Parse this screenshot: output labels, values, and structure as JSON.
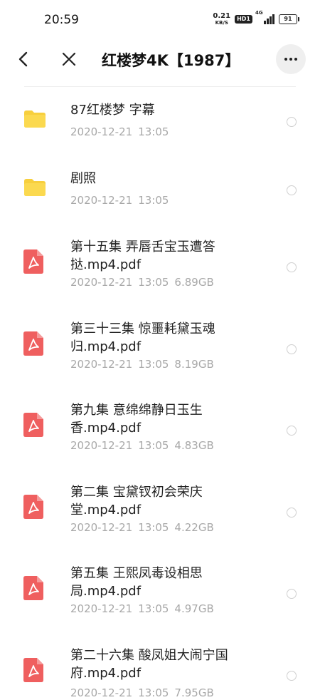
{
  "status_bar": {
    "time": "20:59",
    "net_speed_value": "0.21",
    "net_speed_unit": "KB/S",
    "hd_label": "HD1",
    "network_label": "4G",
    "battery": "91"
  },
  "header": {
    "title": "红楼梦4K【1987】",
    "back_icon": "back-arrow-icon",
    "close_icon": "close-icon",
    "more_icon": "more-horizontal-icon"
  },
  "colors": {
    "folder": "#f7cf3d",
    "pdf": "#ef5f5f",
    "meta_text": "#a8a8a8"
  },
  "files": [
    {
      "type": "folder",
      "name_line1": "87红楼梦 字幕",
      "name_line2": "",
      "date": "2020-12-21",
      "time": "13:05",
      "size": ""
    },
    {
      "type": "folder",
      "name_line1": "剧照",
      "name_line2": "",
      "date": "2020-12-21",
      "time": "13:05",
      "size": ""
    },
    {
      "type": "pdf",
      "name_line1": "第十五集 弄唇舌宝玉遭答",
      "name_line2": "挞.mp4.pdf",
      "date": "2020-12-21",
      "time": "13:05",
      "size": "6.89GB"
    },
    {
      "type": "pdf",
      "name_line1": "第三十三集 惊噩耗黛玉魂",
      "name_line2": "归.mp4.pdf",
      "date": "2020-12-21",
      "time": "13:05",
      "size": "8.19GB"
    },
    {
      "type": "pdf",
      "name_line1": "第九集 意绵绵静日玉生",
      "name_line2": "香.mp4.pdf",
      "date": "2020-12-21",
      "time": "13:05",
      "size": "4.83GB"
    },
    {
      "type": "pdf",
      "name_line1": "第二集 宝黛钗初会荣庆",
      "name_line2": "堂.mp4.pdf",
      "date": "2020-12-21",
      "time": "13:05",
      "size": "4.22GB"
    },
    {
      "type": "pdf",
      "name_line1": "第五集 王熙凤毒设相思",
      "name_line2": "局.mp4.pdf",
      "date": "2020-12-21",
      "time": "13:05",
      "size": "4.97GB"
    },
    {
      "type": "pdf",
      "name_line1": "第二十六集 酸凤姐大闹宁国",
      "name_line2": "府.mp4.pdf",
      "date": "2020-12-21",
      "time": "13:05",
      "size": "7.95GB"
    }
  ]
}
